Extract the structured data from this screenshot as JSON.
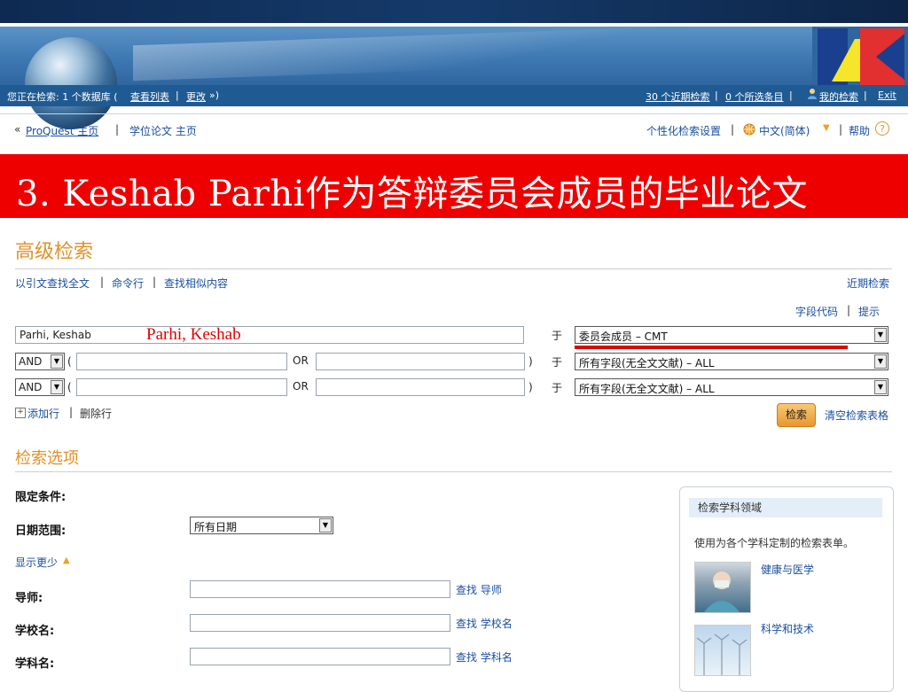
{
  "status": {
    "prefix": "您正在检索: 1 个数据库 (",
    "view_list": "查看列表",
    "sep1": " | ",
    "change": "更改",
    "suffix": " »)",
    "recent": "30 个近期检索",
    "sep2": " | ",
    "selected": "0 个所选条目",
    "sep3": " | ",
    "my_search": "我的检索",
    "sep4": " | ",
    "exit": "Exit"
  },
  "subnav": {
    "back_arrow": "«",
    "proquest_home": "ProQuest 主页",
    "sep": "|",
    "dissertation_home": "学位论文 主页",
    "personalize": "个性化检索设置",
    "sep2": "|",
    "language": "中文(简体)",
    "sep3": "|",
    "help": "帮助"
  },
  "overlay_title": "3. Keshab Parhi作为答辩委员会成员的毕业论文",
  "page_title": "高级检索",
  "links_row": {
    "cite": "以引文查找全文",
    "sep1": "|",
    "command": "命令行",
    "sep2": "|",
    "similar": "查找相似内容",
    "recent": "近期检索"
  },
  "field_code": "字段代码",
  "field_sep": "|",
  "tips": "提示",
  "query_rows": [
    {
      "value": "Parhi, Keshab",
      "in_label": "于",
      "field": "委员会成员 – CMT"
    },
    {
      "op": "AND",
      "open": "(",
      "or": "OR",
      "close": ")",
      "in_label": "于",
      "field": "所有字段(无全文文献) – ALL"
    },
    {
      "op": "AND",
      "open": "(",
      "or": "OR",
      "close": ")",
      "in_label": "于",
      "field": "所有字段(无全文文献) – ALL"
    }
  ],
  "annotation_red": "Parhi, Keshab",
  "add_row": "添加行",
  "row_sep": "|",
  "delete_row": "删除行",
  "search_button": "检索",
  "clear_form": "清空检索表格",
  "options_title": "检索选项",
  "limits_label": "限定条件:",
  "date_label": "日期范围:",
  "date_value": "所有日期",
  "show_less": "显示更少",
  "advisor_label": "导师:",
  "advisor_link": "查找 导师",
  "school_label": "学校名:",
  "school_link": "查找 学校名",
  "subject_label": "学科名:",
  "subject_link": "查找 学科名",
  "sidebar": {
    "header": "检索学科领域",
    "desc": "使用为各个学科定制的检索表单。",
    "item1": "健康与医学",
    "item2": "科学和技术"
  },
  "colors": {
    "accent_orange": "#e0922a",
    "banner_red": "#ee0000",
    "link_blue": "#1a4fa0",
    "navy": "#1f5a92"
  }
}
